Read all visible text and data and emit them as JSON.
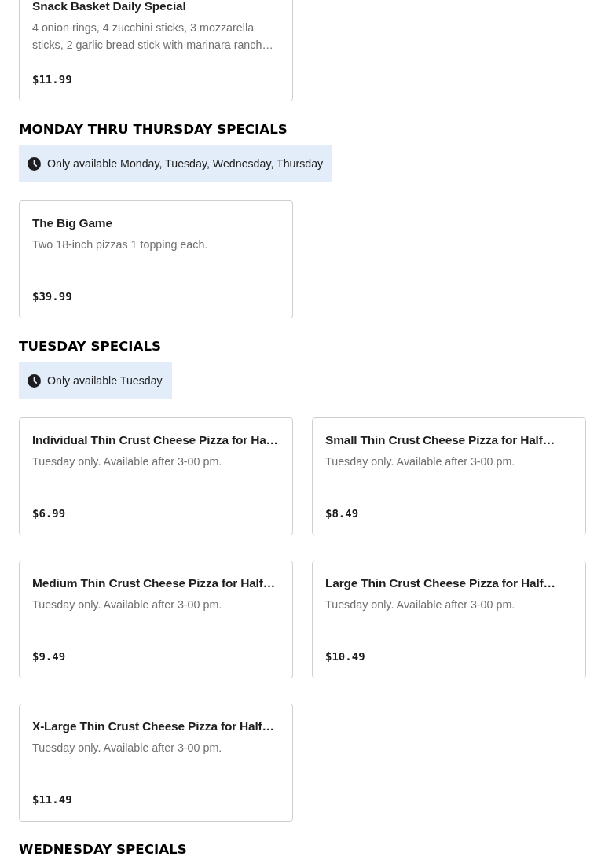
{
  "sections": [
    {
      "items": [
        {
          "title": "Snack Basket Daily Special",
          "description": "4 onion rings, 4 zucchini sticks, 3 mozzarella sticks, 2 garlic bread stick with marinara ranch…",
          "price": "$11.99"
        }
      ]
    },
    {
      "heading": "MONDAY THRU THURSDAY SPECIALS",
      "availability": "Only available Monday, Tuesday, Wednesday, Thursday",
      "items": [
        {
          "title": "The Big Game",
          "description": "Two 18-inch pizzas 1 topping each.",
          "price": "$39.99"
        }
      ]
    },
    {
      "heading": "TUESDAY SPECIALS",
      "availability": "Only available Tuesday",
      "items": [
        {
          "title": "Individual Thin Crust Cheese Pizza for Ha…",
          "description": "Tuesday only. Available after 3-00 pm.",
          "price": "$6.99"
        },
        {
          "title": "Small Thin Crust Cheese Pizza for Half…",
          "description": "Tuesday only. Available after 3-00 pm.",
          "price": "$8.49"
        },
        {
          "title": "Medium Thin Crust Cheese Pizza for Half…",
          "description": "Tuesday only. Available after 3-00 pm.",
          "price": "$9.49"
        },
        {
          "title": "Large Thin Crust Cheese Pizza for Half…",
          "description": "Tuesday only. Available after 3-00 pm.",
          "price": "$10.49"
        },
        {
          "title": "X-Large Thin Crust Cheese Pizza for Half…",
          "description": "Tuesday only. Available after 3-00 pm.",
          "price": "$11.49"
        }
      ]
    },
    {
      "heading": "WEDNESDAY SPECIALS"
    }
  ]
}
